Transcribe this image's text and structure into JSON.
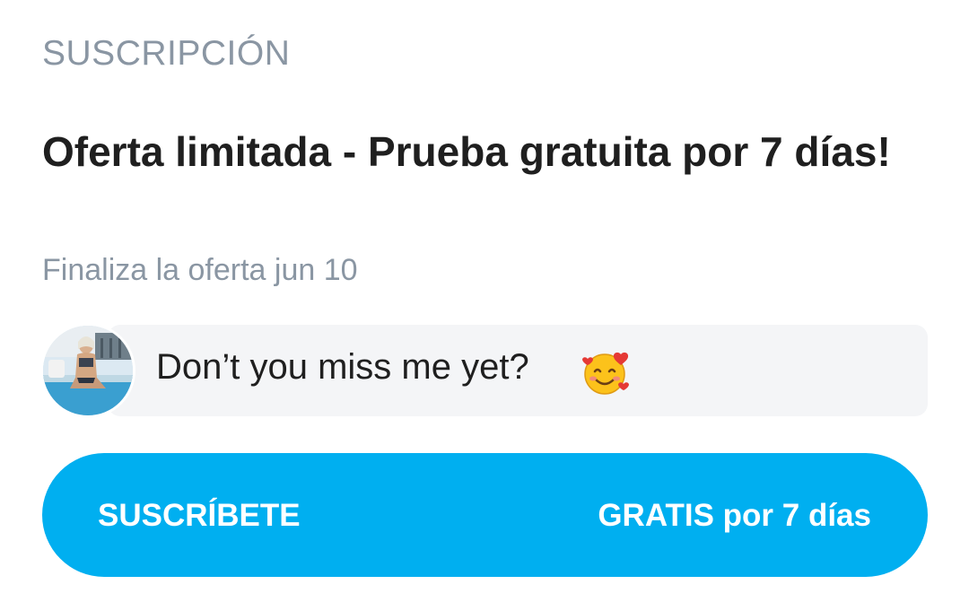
{
  "section": {
    "label": "SUSCRIPCIÓN"
  },
  "offer": {
    "title": "Oferta limitada - Prueba gratuita por 7 días!",
    "ends": "Finaliza la oferta jun 10"
  },
  "message": {
    "text": "Don’t you miss me yet?",
    "emoji": "smiling-face-with-hearts-icon"
  },
  "cta": {
    "left_label": "SUSCRÍBETE",
    "right_label": "GRATIS por 7 días",
    "color": "#00aff0"
  },
  "colors": {
    "muted_text": "#8a96a3",
    "primary_text": "#1f1f1f",
    "bubble_bg": "#f4f5f7"
  }
}
